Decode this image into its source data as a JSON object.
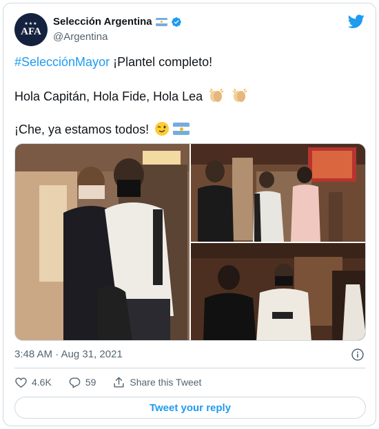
{
  "author": {
    "display_name": "Selección Argentina",
    "handle": "@Argentina",
    "avatar_text": "AFA",
    "avatar_stars": "★★★",
    "verified": true
  },
  "tweet": {
    "hashtag": "#SelecciónMayor",
    "line1_rest": " ¡Plantel completo!",
    "line2": "Hola Capitán, Hola Fide, Hola Lea",
    "line3": "¡Che, ya estamos todos!"
  },
  "meta": {
    "timestamp": "3:48 AM · Aug 31, 2021"
  },
  "actions": {
    "likes": "4.6K",
    "replies": "59",
    "share_label": "Share this Tweet"
  },
  "reply_button": "Tweet your reply",
  "colors": {
    "accent": "#1d9bf0",
    "secondary_text": "#536471",
    "border": "#cfd9de",
    "flag_blue": "#74acdf"
  }
}
